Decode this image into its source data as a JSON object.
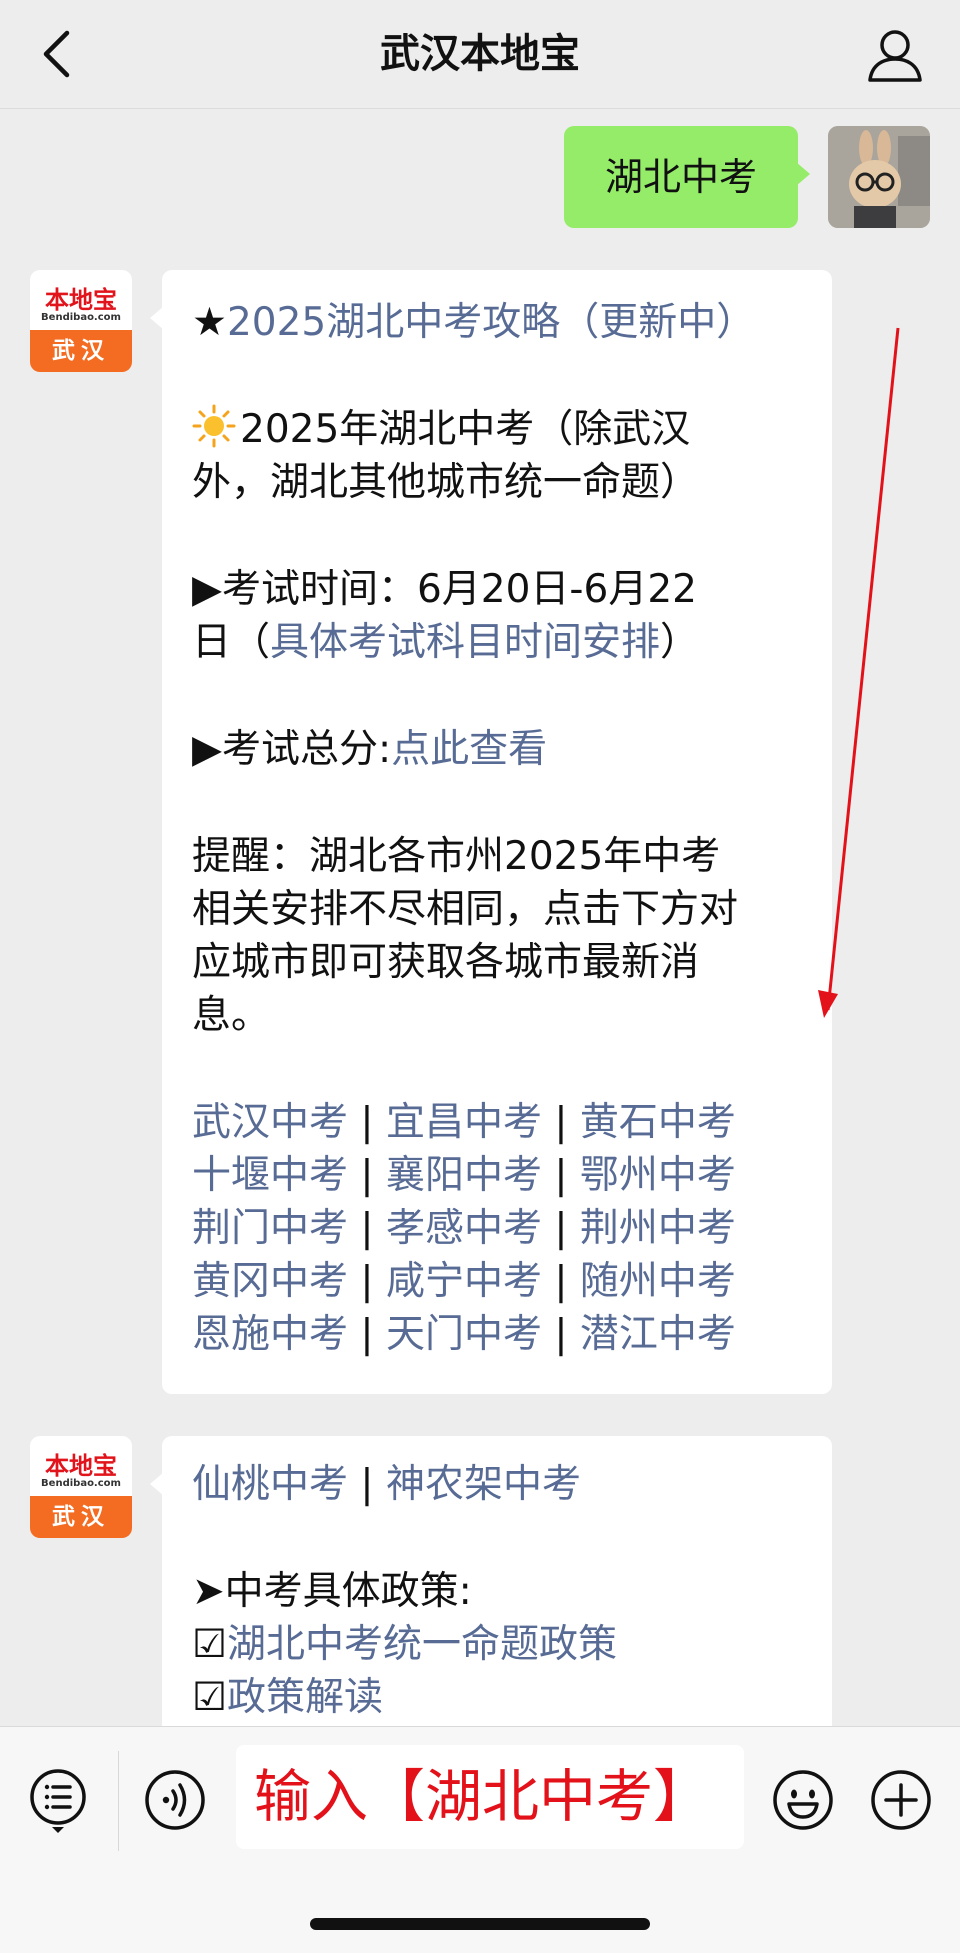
{
  "header": {
    "title": "武汉本地宝"
  },
  "outgoing_message": {
    "text": "湖北中考"
  },
  "account": {
    "brand": "本地宝",
    "domain": "Bendibao.com",
    "city": "武汉"
  },
  "message1": {
    "headline_star": "★",
    "headline_link": "2025湖北中考攻略（更新中）",
    "intro_line1": "2025年湖北中考（除武汉",
    "intro_line2": "外，湖北其他城市统一命题）",
    "time_line1": "▶考试时间：6月20日-6月22",
    "time_line2_pre": "日（",
    "time_link": "具体考试科目时间安排",
    "time_line2_post": "）",
    "score_label": "▶考试总分:",
    "score_link": "点此查看",
    "reminder_line1": "提醒：湖北各市州2025年中考",
    "reminder_line2": "相关安排不尽相同，点击下方对",
    "reminder_line3": "应城市即可获取各城市最新消",
    "reminder_line4": "息。",
    "separator": " | ",
    "city_rows": [
      [
        "武汉中考",
        "宜昌中考",
        "黄石中考"
      ],
      [
        "十堰中考",
        "襄阳中考",
        "鄂州中考"
      ],
      [
        "荆门中考",
        "孝感中考",
        "荆州中考"
      ],
      [
        "黄冈中考",
        "咸宁中考",
        "随州中考"
      ],
      [
        "恩施中考",
        "天门中考",
        "潜江中考"
      ]
    ]
  },
  "message2": {
    "cities": [
      "仙桃中考",
      "神农架中考"
    ],
    "policy_title": "➤中考具体政策:",
    "check_mark": "☑",
    "policy_items": [
      "湖北中考统一命题政策",
      "政策解读"
    ]
  },
  "input": {
    "value": "输入【湖北中考】"
  },
  "colors": {
    "link": "#576b95",
    "outgoing_bubble": "#95ec69",
    "annotation_red": "#e3121a",
    "brand_orange": "#f36c21"
  }
}
